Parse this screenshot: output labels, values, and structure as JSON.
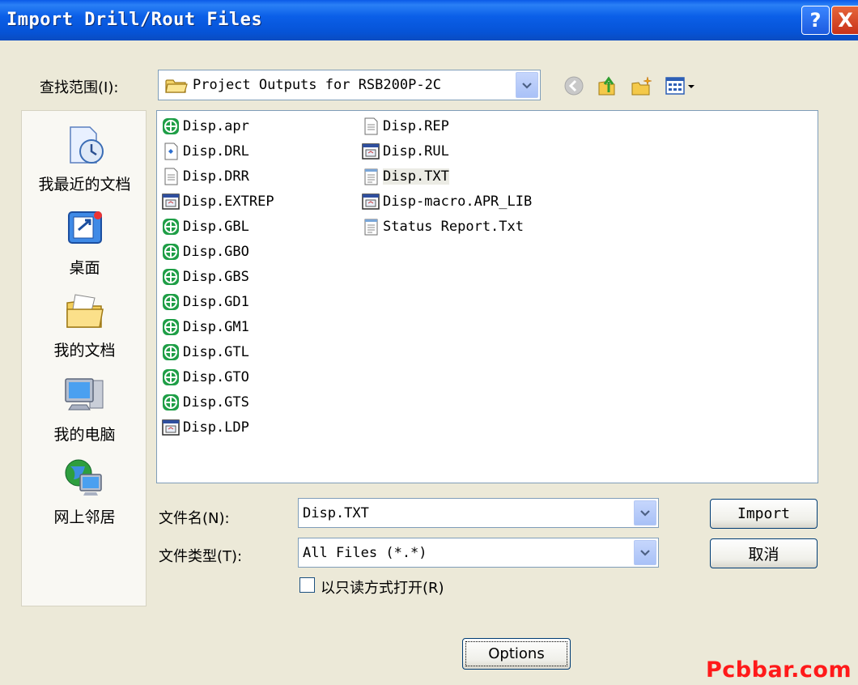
{
  "window": {
    "title": "Import Drill/Rout Files",
    "help_label": "?",
    "close_label": "X"
  },
  "look_in": {
    "label": "查找范围(I):",
    "value": "Project Outputs for RSB200P-2C"
  },
  "toolbar_icons": [
    "back-icon",
    "up-folder-icon",
    "new-folder-icon",
    "view-menu-icon"
  ],
  "places": [
    {
      "label": "我最近的文档",
      "icon": "recent-documents-icon"
    },
    {
      "label": "桌面",
      "icon": "desktop-icon"
    },
    {
      "label": "我的文档",
      "icon": "my-documents-icon"
    },
    {
      "label": "我的电脑",
      "icon": "my-computer-icon"
    },
    {
      "label": "网上邻居",
      "icon": "network-places-icon"
    }
  ],
  "files": [
    {
      "name": "Disp.apr",
      "icon": "gerber-icon"
    },
    {
      "name": "Disp.DRL",
      "icon": "drill-file-icon"
    },
    {
      "name": "Disp.DRR",
      "icon": "text-file-icon"
    },
    {
      "name": "Disp.EXTREP",
      "icon": "report-icon"
    },
    {
      "name": "Disp.GBL",
      "icon": "gerber-icon"
    },
    {
      "name": "Disp.GBO",
      "icon": "gerber-icon"
    },
    {
      "name": "Disp.GBS",
      "icon": "gerber-icon"
    },
    {
      "name": "Disp.GD1",
      "icon": "gerber-icon"
    },
    {
      "name": "Disp.GM1",
      "icon": "gerber-icon"
    },
    {
      "name": "Disp.GTL",
      "icon": "gerber-icon"
    },
    {
      "name": "Disp.GTO",
      "icon": "gerber-icon"
    },
    {
      "name": "Disp.GTS",
      "icon": "gerber-icon"
    },
    {
      "name": "Disp.LDP",
      "icon": "report-icon"
    },
    {
      "name": "Disp.REP",
      "icon": "text-file-icon"
    },
    {
      "name": "Disp.RUL",
      "icon": "report-icon"
    },
    {
      "name": "Disp.TXT",
      "icon": "notepad-icon",
      "selected": true
    },
    {
      "name": "Disp-macro.APR_LIB",
      "icon": "report-icon"
    },
    {
      "name": "Status Report.Txt",
      "icon": "notepad-icon"
    }
  ],
  "filename": {
    "label": "文件名(N):",
    "value": "Disp.TXT"
  },
  "filetype": {
    "label": "文件类型(T):",
    "value": "All Files (*.*)"
  },
  "readonly": {
    "label": "以只读方式打开(R)",
    "checked": false
  },
  "buttons": {
    "import": "Import",
    "cancel": "取消",
    "options": "Options"
  },
  "watermark": "Pcbbar.com"
}
